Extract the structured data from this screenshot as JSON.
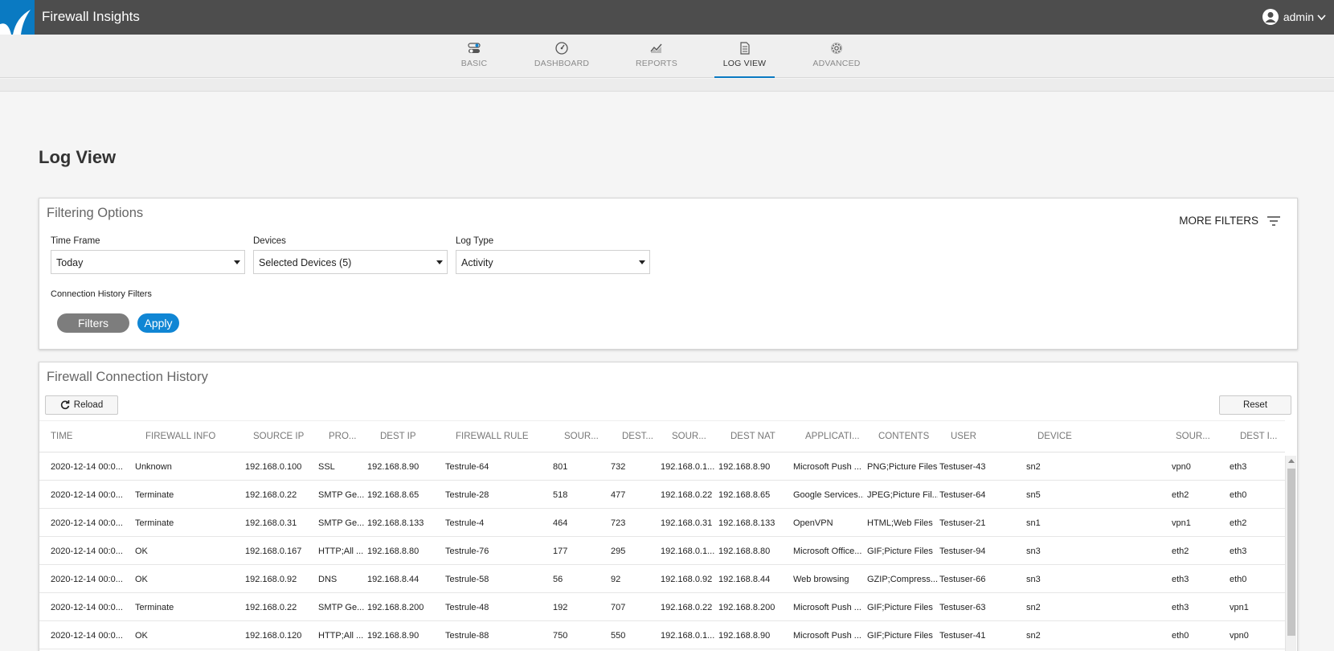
{
  "app": {
    "title": "Firewall Insights",
    "user": "admin"
  },
  "nav": {
    "tabs": [
      {
        "label": "BASIC",
        "icon": "toggles-icon"
      },
      {
        "label": "DASHBOARD",
        "icon": "speedometer-icon"
      },
      {
        "label": "REPORTS",
        "icon": "chart-icon"
      },
      {
        "label": "LOG VIEW",
        "icon": "document-icon",
        "active": true
      },
      {
        "label": "ADVANCED",
        "icon": "gear-icon"
      }
    ]
  },
  "page": {
    "title": "Log View"
  },
  "filtering": {
    "title": "Filtering Options",
    "more_filters": "MORE FILTERS",
    "time_frame": {
      "label": "Time Frame",
      "value": "Today"
    },
    "devices": {
      "label": "Devices",
      "value": "Selected Devices (5)"
    },
    "log_type": {
      "label": "Log Type",
      "value": "Activity"
    },
    "connection_history_label": "Connection History Filters",
    "filters_button": "Filters",
    "apply_button": "Apply"
  },
  "history": {
    "title": "Firewall Connection History",
    "reload_button": "Reload",
    "reset_button": "Reset",
    "columns": [
      "TIME",
      "FIREWALL INFO",
      "SOURCE IP",
      "PRO...",
      "DEST IP",
      "FIREWALL RULE",
      "SOUR...",
      "DEST...",
      "SOUR...",
      "DEST NAT",
      "APPLICATI...",
      "CONTENTS",
      "USER",
      "DEVICE",
      "SOUR...",
      "DEST I..."
    ],
    "rows": [
      [
        "2020-12-14 00:0...",
        "Unknown",
        "192.168.0.100",
        "SSL",
        "192.168.8.90",
        "Testrule-64",
        "801",
        "732",
        "192.168.0.1...",
        "192.168.8.90",
        "Microsoft Push ...",
        "PNG;Picture Files",
        "Testuser-43",
        "sn2",
        "vpn0",
        "eth3"
      ],
      [
        "2020-12-14 00:0...",
        "Terminate",
        "192.168.0.22",
        "SMTP Ge...",
        "192.168.8.65",
        "Testrule-28",
        "518",
        "477",
        "192.168.0.22",
        "192.168.8.65",
        "Google Services...",
        "JPEG;Picture Fil...",
        "Testuser-64",
        "sn5",
        "eth2",
        "eth0"
      ],
      [
        "2020-12-14 00:0...",
        "Terminate",
        "192.168.0.31",
        "SMTP Ge...",
        "192.168.8.133",
        "Testrule-4",
        "464",
        "723",
        "192.168.0.31",
        "192.168.8.133",
        "OpenVPN",
        "HTML;Web Files",
        "Testuser-21",
        "sn1",
        "vpn1",
        "eth2"
      ],
      [
        "2020-12-14 00:0...",
        "OK",
        "192.168.0.167",
        "HTTP;All ...",
        "192.168.8.80",
        "Testrule-76",
        "177",
        "295",
        "192.168.0.1...",
        "192.168.8.80",
        "Microsoft Office...",
        "GIF;Picture Files",
        "Testuser-94",
        "sn3",
        "eth2",
        "eth3"
      ],
      [
        "2020-12-14 00:0...",
        "OK",
        "192.168.0.92",
        "DNS",
        "192.168.8.44",
        "Testrule-58",
        "56",
        "92",
        "192.168.0.92",
        "192.168.8.44",
        "Web browsing",
        "GZIP;Compress...",
        "Testuser-66",
        "sn3",
        "eth3",
        "eth0"
      ],
      [
        "2020-12-14 00:0...",
        "Terminate",
        "192.168.0.22",
        "SMTP Ge...",
        "192.168.8.200",
        "Testrule-48",
        "192",
        "707",
        "192.168.0.22",
        "192.168.8.200",
        "Microsoft Push ...",
        "GIF;Picture Files",
        "Testuser-63",
        "sn2",
        "eth3",
        "vpn1"
      ],
      [
        "2020-12-14 00:0...",
        "OK",
        "192.168.0.120",
        "HTTP;All ...",
        "192.168.8.90",
        "Testrule-88",
        "750",
        "550",
        "192.168.0.1...",
        "192.168.8.90",
        "Microsoft Push ...",
        "GIF;Picture Files",
        "Testuser-41",
        "sn2",
        "eth0",
        "vpn0"
      ]
    ]
  },
  "colors": {
    "accent": "#0a7ac2",
    "topbar": "#4d4d4d",
    "apply": "#1086d4",
    "filters": "#7d7d7d"
  }
}
